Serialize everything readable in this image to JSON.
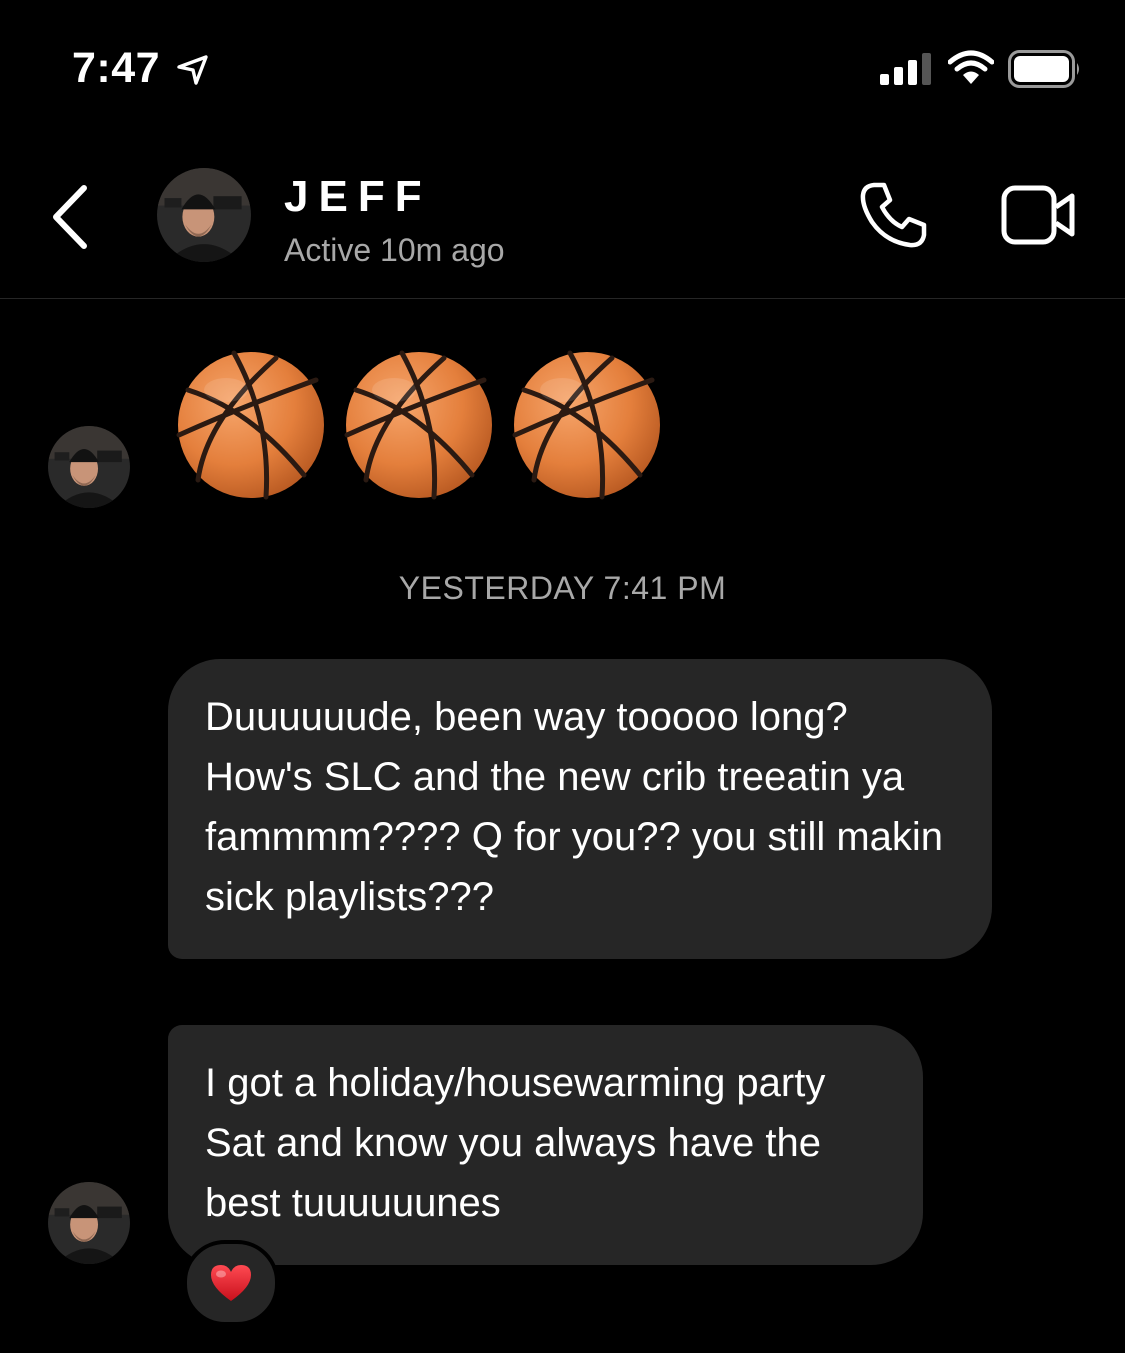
{
  "status_bar": {
    "time": "7:47"
  },
  "header": {
    "contact_name": "JEFF",
    "contact_status": "Active 10m ago"
  },
  "thread": {
    "emoji_message": [
      "basketball-emoji",
      "basketball-emoji",
      "basketball-emoji"
    ],
    "timestamp": "YESTERDAY 7:41 PM",
    "messages": [
      {
        "text": "Duuuuuude, been way tooooo long? How's SLC and the new crib treeatin ya fammmm???? Q for you?? you still makin sick playlists???"
      },
      {
        "text": "I got a holiday/housewarming party Sat and know you always have the best tuuuuuunes"
      }
    ],
    "reaction": "heart-emoji"
  },
  "colors": {
    "background": "#000000",
    "bubble": "#262626",
    "secondary_text": "#a8a8a8",
    "heart": "#e0202a",
    "basketball": "#e9884a"
  }
}
